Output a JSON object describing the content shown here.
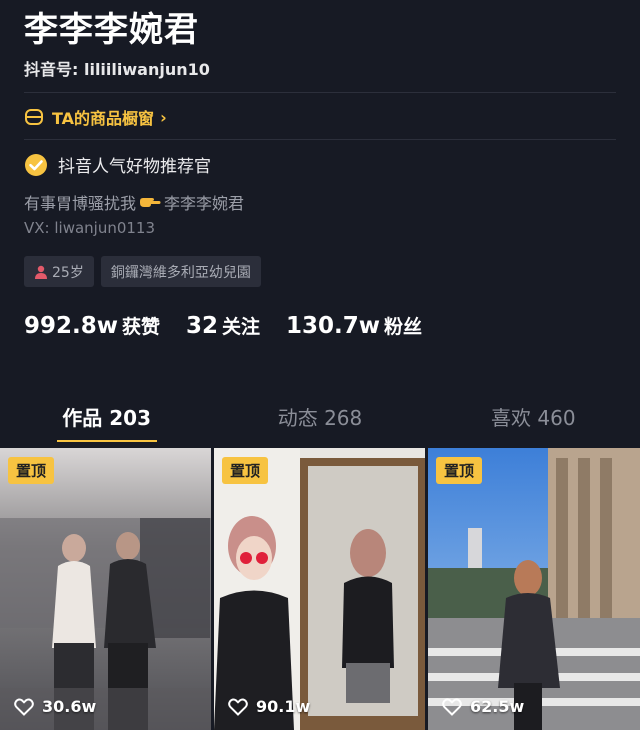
{
  "profile": {
    "name": "李李李婉君",
    "douyin_id": "抖音号: liliiliwanjun10",
    "shop_label": "TA的商品橱窗",
    "verify_label": "抖音人气好物推荐官",
    "bio_text": "有事胃博骚扰我",
    "bio_name": "李李李婉君",
    "bio_vx": "VX: liwanjun0113",
    "tags": [
      {
        "label": "25岁"
      },
      {
        "label": "銅鑼灣維多利亞幼兒園"
      }
    ]
  },
  "stats": [
    {
      "value": "992.8w",
      "label": "获赞"
    },
    {
      "value": "32",
      "label": "关注"
    },
    {
      "value": "130.7w",
      "label": "粉丝"
    }
  ],
  "tabs": [
    {
      "label": "作品 203"
    },
    {
      "label": "动态 268"
    },
    {
      "label": "喜欢 460"
    }
  ],
  "videos": [
    {
      "pin": "置顶",
      "likes": "30.6w"
    },
    {
      "pin": "置顶",
      "likes": "90.1w"
    },
    {
      "pin": "置顶",
      "likes": "62.5w"
    }
  ],
  "colors": {
    "background": "#171a24",
    "accent": "#f7c341",
    "muted": "#9b9ea8"
  }
}
